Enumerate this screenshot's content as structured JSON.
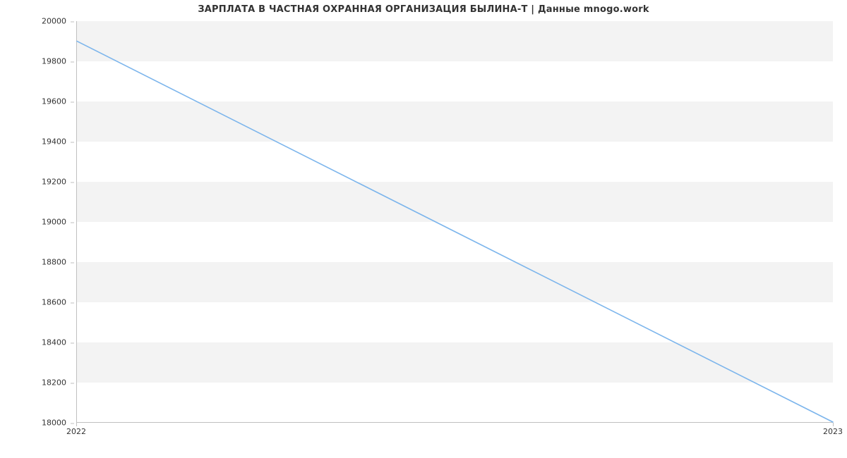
{
  "chart_data": {
    "type": "line",
    "title": "ЗАРПЛАТА В  ЧАСТНАЯ ОХРАННАЯ ОРГАНИЗАЦИЯ БЫЛИНА-Т | Данные mnogo.work",
    "x": [
      2022,
      2023
    ],
    "values": [
      19900,
      18000
    ],
    "x_ticks": [
      "2022",
      "2023"
    ],
    "y_ticks": [
      "18000",
      "18200",
      "18400",
      "18600",
      "18800",
      "19000",
      "19200",
      "19400",
      "19600",
      "19800",
      "20000"
    ],
    "ylim": [
      18000,
      20000
    ],
    "xlim": [
      2022,
      2023
    ],
    "line_color": "#7cb5ec",
    "band_color": "#f3f3f3"
  }
}
